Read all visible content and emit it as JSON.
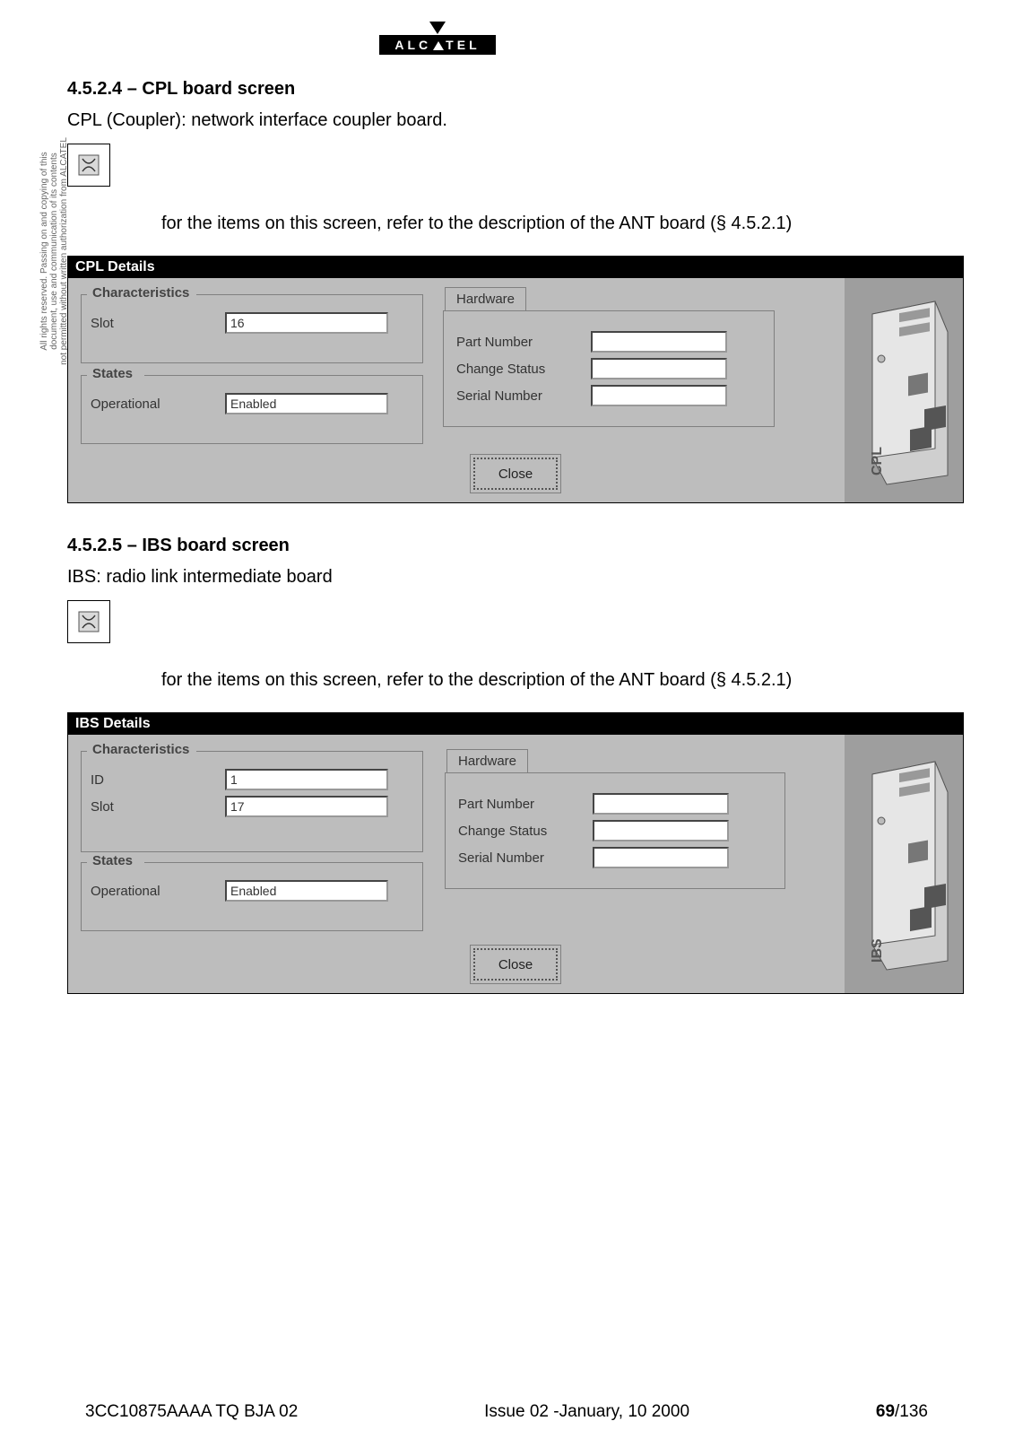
{
  "logo": {
    "brand": "ALCATEL"
  },
  "side_note": {
    "line1": "All rights reserved. Passing on and copying of this",
    "line2": "document, use and communication of its contents",
    "line3": "not permitted without written authorization from ALCATEL"
  },
  "section_cpl": {
    "heading": "4.5.2.4 – CPL board screen",
    "desc": "CPL (Coupler): network interface coupler board.",
    "reference": "for the items on this screen, refer to the description of the ANT board (§ 4.5.2.1)",
    "dialog": {
      "title": "CPL Details",
      "characteristics": {
        "legend": "Characteristics",
        "slot_label": "Slot",
        "slot_value": "16"
      },
      "states": {
        "legend": "States",
        "operational_label": "Operational",
        "operational_value": "Enabled"
      },
      "hardware": {
        "tab": "Hardware",
        "part_number_label": "Part Number",
        "part_number_value": "",
        "change_status_label": "Change Status",
        "change_status_value": "",
        "serial_number_label": "Serial Number",
        "serial_number_value": ""
      },
      "board_label": "CPL",
      "close": "Close"
    }
  },
  "section_ibs": {
    "heading": "4.5.2.5 – IBS board screen",
    "desc": "IBS: radio link intermediate board",
    "reference": "for the items on this screen, refer to the description of the ANT board (§ 4.5.2.1)",
    "dialog": {
      "title": "IBS Details",
      "characteristics": {
        "legend": "Characteristics",
        "id_label": "ID",
        "id_value": "1",
        "slot_label": "Slot",
        "slot_value": "17"
      },
      "states": {
        "legend": "States",
        "operational_label": "Operational",
        "operational_value": "Enabled"
      },
      "hardware": {
        "tab": "Hardware",
        "part_number_label": "Part Number",
        "part_number_value": "",
        "change_status_label": "Change Status",
        "change_status_value": "",
        "serial_number_label": "Serial Number",
        "serial_number_value": ""
      },
      "board_label": "IBS",
      "close": "Close"
    }
  },
  "footer": {
    "doc_ref": "3CC10875AAAA TQ BJA 02",
    "issue": "Issue 02 -January, 10 2000",
    "page_current": "69",
    "page_total": "/136"
  }
}
